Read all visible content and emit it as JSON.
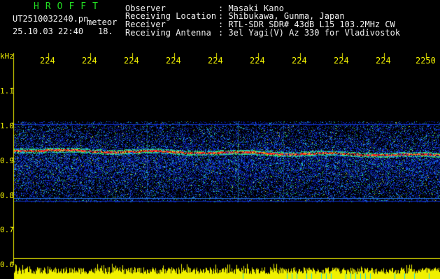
{
  "header": {
    "station_name": "HROFFT",
    "file_name": "UT2510032240.pn",
    "mode": "meteor",
    "datetime": "25.10.03 22:40",
    "count": "18.",
    "observer_label": "Observer",
    "observer_value": ": Masaki Kano",
    "location_label": "Receiving Location",
    "location_value": ": Shibukawa, Gunma, Japan",
    "receiver_label": "Receiver",
    "receiver_value": ": RTL-SDR SDR# 43dB L15 103.2MHz CW",
    "antenna_label": "Receiving Antenna",
    "antenna_value": ": 3el Yagi(V) Az 330 for Vladivostok"
  },
  "spectrogram": {
    "y_unit": "kHz",
    "y_ticks": [
      "1.1",
      "1.0",
      "0.9",
      "0.8",
      "0.7",
      "0.6"
    ],
    "x_ticks": [
      "224",
      "224",
      "224",
      "224",
      "224",
      "224",
      "224",
      "224",
      "224",
      "2250"
    ],
    "colors": {
      "axis": "#f0f000",
      "noise_band": "#1030c0",
      "trace": "#ff2020",
      "bottom_bars": "#f0f000"
    }
  }
}
